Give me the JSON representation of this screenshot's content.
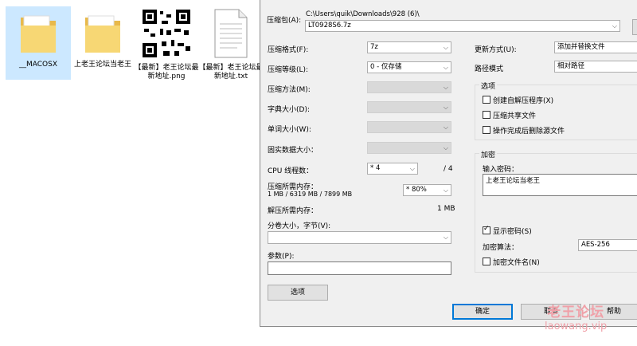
{
  "desktop": {
    "items": [
      {
        "label": "__MACOSX"
      },
      {
        "label": "上老王论坛当老王"
      },
      {
        "label": "【最新】老王论坛最新地址.png"
      },
      {
        "label": "【最新】老王论坛最新地址.txt"
      }
    ]
  },
  "dialog": {
    "archive_label": "压缩包(A):",
    "archive_path": "C:\\Users\\quik\\Downloads\\928 (6)\\",
    "archive_name": "LT0928S6.7z",
    "format_label": "压缩格式(F):",
    "format_value": "7z",
    "level_label": "压缩等级(L):",
    "level_value": "0 - 仅存储",
    "method_label": "压缩方法(M):",
    "dict_label": "字典大小(D):",
    "word_label": "单词大小(W):",
    "solid_label": "固实数据大小：",
    "cpu_label": "CPU 线程数：",
    "cpu_value": "* 4",
    "cpu_total": "/ 4",
    "mem_label": "压缩所需内存：",
    "mem_detail": "1 MB / 6319 MB / 7899 MB",
    "mem_value": "* 80%",
    "decomp_label": "解压所需内存：",
    "decomp_value": "1 MB",
    "volume_label": "分卷大小，字节(V):",
    "params_label": "参数(P):",
    "options_button": "选项",
    "update_label": "更新方式(U):",
    "update_value": "添加并替换文件",
    "path_label": "路径模式",
    "path_value": "相对路径",
    "options_group": "选项",
    "opt_sfx": "创建自解压程序(X)",
    "opt_shared": "压缩共享文件",
    "opt_delete": "操作完成后删除源文件",
    "enc_group": "加密",
    "pwd_label": "输入密码：",
    "pwd_value": "上老王论坛当老王",
    "show_pwd": "显示密码(S)",
    "enc_method_label": "加密算法：",
    "enc_method_value": "AES-256",
    "enc_names": "加密文件名(N)",
    "ok": "确定",
    "cancel": "取消",
    "help": "帮助"
  },
  "watermark": {
    "line1": "老王论坛",
    "line2": "laowang.vip"
  },
  "colors": {
    "selection": "#cce8ff",
    "dialog_bg": "#f0f0f0",
    "default_button": "#0078d7"
  }
}
